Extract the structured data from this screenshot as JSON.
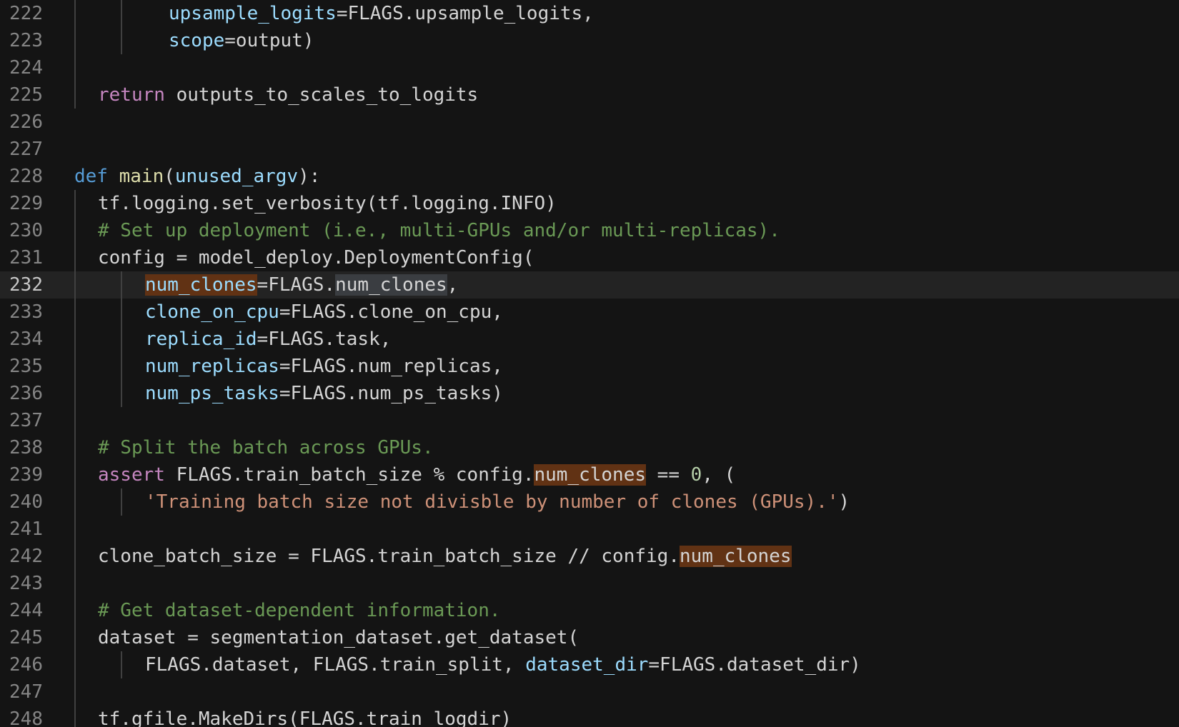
{
  "editor": {
    "current_line": 232,
    "lines": [
      {
        "num": "222",
        "indent": 4,
        "parts": [
          {
            "t": "upsample_logits",
            "c": "param"
          },
          {
            "t": "=FLAGS.upsample_logits,",
            "c": ""
          }
        ]
      },
      {
        "num": "223",
        "indent": 4,
        "parts": [
          {
            "t": "scope",
            "c": "param"
          },
          {
            "t": "=output)",
            "c": ""
          }
        ]
      },
      {
        "num": "224",
        "indent": 0,
        "parts": []
      },
      {
        "num": "225",
        "indent": 1,
        "parts": [
          {
            "t": "return",
            "c": "kw"
          },
          {
            "t": " outputs_to_scales_to_logits",
            "c": ""
          }
        ]
      },
      {
        "num": "226",
        "indent": 0,
        "parts": []
      },
      {
        "num": "227",
        "indent": 0,
        "parts": []
      },
      {
        "num": "228",
        "indent": 0,
        "parts": [
          {
            "t": "def",
            "c": "kw-def"
          },
          {
            "t": " ",
            "c": ""
          },
          {
            "t": "main",
            "c": "fn"
          },
          {
            "t": "(",
            "c": ""
          },
          {
            "t": "unused_argv",
            "c": "param"
          },
          {
            "t": "):",
            "c": ""
          }
        ]
      },
      {
        "num": "229",
        "indent": 1,
        "parts": [
          {
            "t": "tf.logging.set_verbosity(tf.logging.INFO)",
            "c": ""
          }
        ]
      },
      {
        "num": "230",
        "indent": 1,
        "parts": [
          {
            "t": "# Set up deployment (i.e., multi-GPUs and/or multi-replicas).",
            "c": "cm"
          }
        ]
      },
      {
        "num": "231",
        "indent": 1,
        "parts": [
          {
            "t": "config = model_deploy.DeploymentConfig(",
            "c": ""
          }
        ]
      },
      {
        "num": "232",
        "indent": 3,
        "parts": [
          {
            "t": "num_clones",
            "c": "param hl-orange"
          },
          {
            "t": "=FLAGS.",
            "c": ""
          },
          {
            "t": "num_clones",
            "c": "hl-sel"
          },
          {
            "t": ",",
            "c": ""
          }
        ]
      },
      {
        "num": "233",
        "indent": 3,
        "parts": [
          {
            "t": "clone_on_cpu",
            "c": "param"
          },
          {
            "t": "=FLAGS.clone_on_cpu,",
            "c": ""
          }
        ]
      },
      {
        "num": "234",
        "indent": 3,
        "parts": [
          {
            "t": "replica_id",
            "c": "param"
          },
          {
            "t": "=FLAGS.task,",
            "c": ""
          }
        ]
      },
      {
        "num": "235",
        "indent": 3,
        "parts": [
          {
            "t": "num_replicas",
            "c": "param"
          },
          {
            "t": "=FLAGS.num_replicas,",
            "c": ""
          }
        ]
      },
      {
        "num": "236",
        "indent": 3,
        "parts": [
          {
            "t": "num_ps_tasks",
            "c": "param"
          },
          {
            "t": "=FLAGS.num_ps_tasks)",
            "c": ""
          }
        ]
      },
      {
        "num": "237",
        "indent": 0,
        "parts": []
      },
      {
        "num": "238",
        "indent": 1,
        "parts": [
          {
            "t": "# Split the batch across GPUs.",
            "c": "cm"
          }
        ]
      },
      {
        "num": "239",
        "indent": 1,
        "parts": [
          {
            "t": "assert",
            "c": "kw"
          },
          {
            "t": " FLAGS.train_batch_size % config.",
            "c": ""
          },
          {
            "t": "num_clones",
            "c": "hl-orange"
          },
          {
            "t": " == ",
            "c": ""
          },
          {
            "t": "0",
            "c": "num"
          },
          {
            "t": ", (",
            "c": ""
          }
        ]
      },
      {
        "num": "240",
        "indent": 3,
        "parts": [
          {
            "t": "'Training batch size not divisble by number of clones (GPUs).'",
            "c": "str"
          },
          {
            "t": ")",
            "c": ""
          }
        ]
      },
      {
        "num": "241",
        "indent": 0,
        "parts": []
      },
      {
        "num": "242",
        "indent": 1,
        "parts": [
          {
            "t": "clone_batch_size = FLAGS.train_batch_size // config.",
            "c": ""
          },
          {
            "t": "num_clones",
            "c": "hl-orange"
          }
        ]
      },
      {
        "num": "243",
        "indent": 0,
        "parts": []
      },
      {
        "num": "244",
        "indent": 1,
        "parts": [
          {
            "t": "# Get dataset-dependent information.",
            "c": "cm"
          }
        ]
      },
      {
        "num": "245",
        "indent": 1,
        "parts": [
          {
            "t": "dataset = segmentation_dataset.get_dataset(",
            "c": ""
          }
        ]
      },
      {
        "num": "246",
        "indent": 3,
        "parts": [
          {
            "t": "FLAGS.dataset, FLAGS.train_split, ",
            "c": ""
          },
          {
            "t": "dataset_dir",
            "c": "param"
          },
          {
            "t": "=FLAGS.dataset_dir)",
            "c": ""
          }
        ]
      },
      {
        "num": "247",
        "indent": 0,
        "parts": []
      },
      {
        "num": "248",
        "indent": 1,
        "parts": [
          {
            "t": "tf.gfile.MakeDirs(FLAGS.train_logdir)",
            "c": ""
          }
        ]
      }
    ]
  }
}
